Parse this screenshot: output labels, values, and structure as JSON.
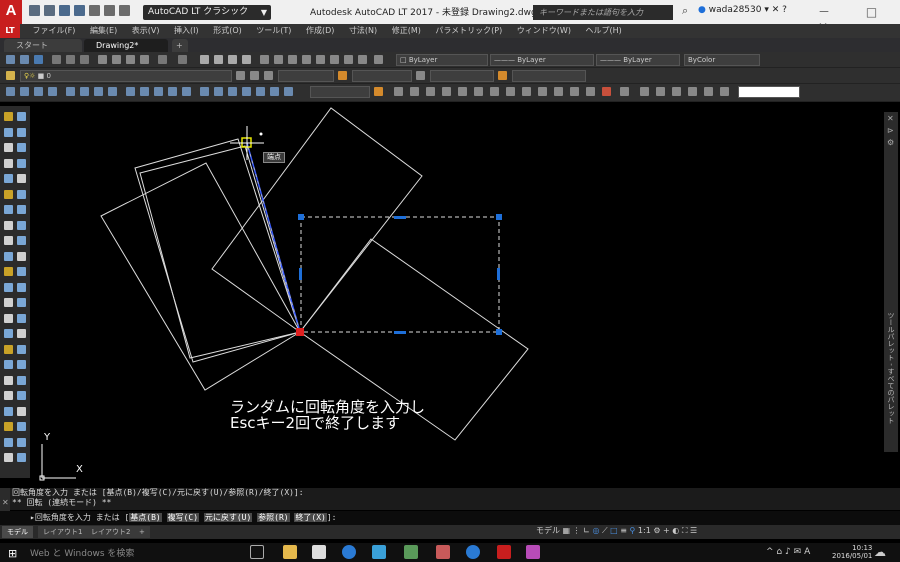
{
  "app": {
    "logo": "A",
    "workspace": "AutoCAD LT クラシック",
    "title": "Autodesk AutoCAD LT 2017 - 未登録   Drawing2.dwg",
    "search_placeholder": "キーワードまたは語句を入力",
    "user": "wada28530",
    "win_controls": "－ □ ✕"
  },
  "menu": [
    "ファイル(F)",
    "編集(E)",
    "表示(V)",
    "挿入(I)",
    "形式(O)",
    "ツール(T)",
    "作成(D)",
    "寸法(N)",
    "修正(M)",
    "パラメトリック(P)",
    "ウィンドウ(W)",
    "ヘルプ(H)"
  ],
  "tabs": {
    "start": "スタート",
    "drawing": "Drawing2*",
    "add": "+"
  },
  "toolbars": {
    "layer_value": "0",
    "bylayer_color": "ByLayer",
    "bylayer_linetype": "ByLayer",
    "bylayer_lineweight": "ByLayer",
    "bycolor": "ByColor"
  },
  "tooltip": "端点",
  "caption": {
    "line1": "ランダムに回転角度を入力し",
    "line2": "Escキー2回で終了します"
  },
  "ucs": {
    "x": "X",
    "y": "Y"
  },
  "command": {
    "history1": "回転角度を入力 または [基点(B)/複写(C)/元に戻す(U)/参照(R)/終了(X)]:",
    "history2": "** 回転 (連続モード) **",
    "prompt_prefix": "回転角度を入力 または [",
    "opt1": "基点(B)",
    "opt2": "複写(C)",
    "opt3": "元に戻す(U)",
    "opt4": "参照(R)",
    "opt5": "終了(X)",
    "suffix": "]:"
  },
  "layout_tabs": [
    "モデル",
    "レイアウト1",
    "レイアウト2",
    "+"
  ],
  "status": {
    "model": "モデル",
    "scale": "1:1"
  },
  "right_palette": "ツールパレット - すべてのパレット",
  "taskbar": {
    "search": "Web と Windows を検索",
    "time": "10:13",
    "date": "2016/05/01",
    "ime": "A"
  },
  "colors": {
    "accent": "#c81e1e",
    "grip": "#1e6fd9",
    "base_point": "#e02020",
    "osnap": "#e6e600"
  }
}
